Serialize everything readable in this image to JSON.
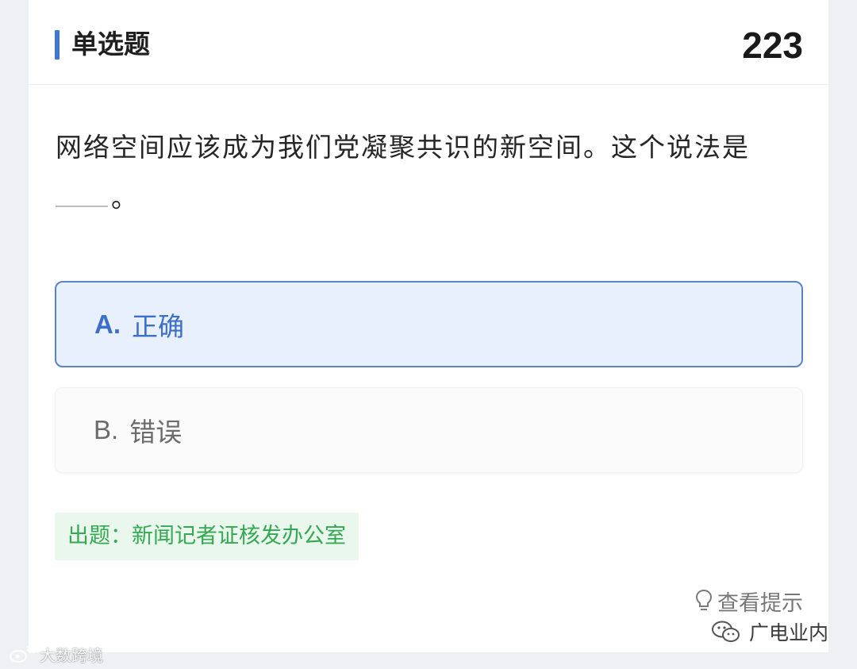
{
  "header": {
    "question_type": "单选题",
    "question_number": "223"
  },
  "question": {
    "text": "网络空间应该成为我们党凝聚共识的新空间。这个说法是",
    "blank_suffix": "。"
  },
  "options": [
    {
      "letter": "A.",
      "label": "正确",
      "selected": true
    },
    {
      "letter": "B.",
      "label": "错误",
      "selected": false
    }
  ],
  "source": {
    "label": "出题：新闻记者证核发办公室"
  },
  "hint": {
    "label": "查看提示",
    "icon": "lightbulb-icon"
  },
  "watermarks": {
    "left": "大数跨境",
    "right": "广电业内",
    "left_icon": "weibo-logo-icon",
    "right_icon": "wechat-logo-icon"
  },
  "colors": {
    "accent": "#3f77d9",
    "selected_bg": "#e8f0fd",
    "selected_border": "#5a82c4",
    "source_text": "#34a853",
    "source_bg": "#e9f7ec"
  }
}
